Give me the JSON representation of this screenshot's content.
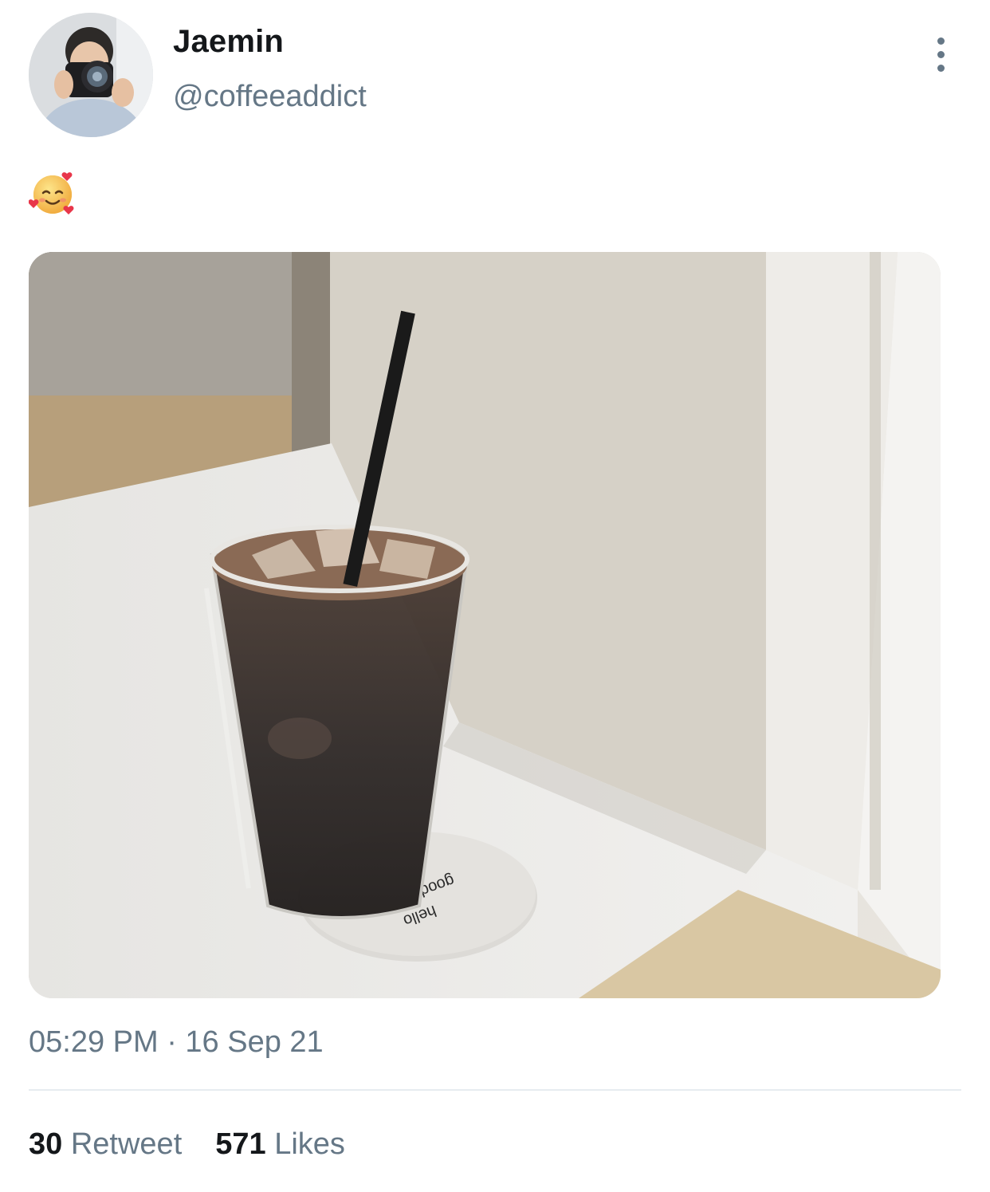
{
  "tweet": {
    "author_name": "Jaemin",
    "author_handle": "@coffeeaddict",
    "text_emoji": "🥰",
    "image_coaster_text_1": "hello",
    "image_coaster_text_2": "good",
    "timestamp": "05:29 PM · 16 Sep 21",
    "stats": {
      "retweets_count": "30",
      "retweets_label": "Retweet",
      "likes_count": "571",
      "likes_label": "Likes"
    }
  },
  "icons": {
    "more_menu": "vertical-ellipsis-icon",
    "emoji": "smiling-face-with-hearts-icon"
  },
  "colors": {
    "secondary_text": "#657786",
    "primary_text": "#14171a",
    "divider": "#e6ecf0"
  }
}
